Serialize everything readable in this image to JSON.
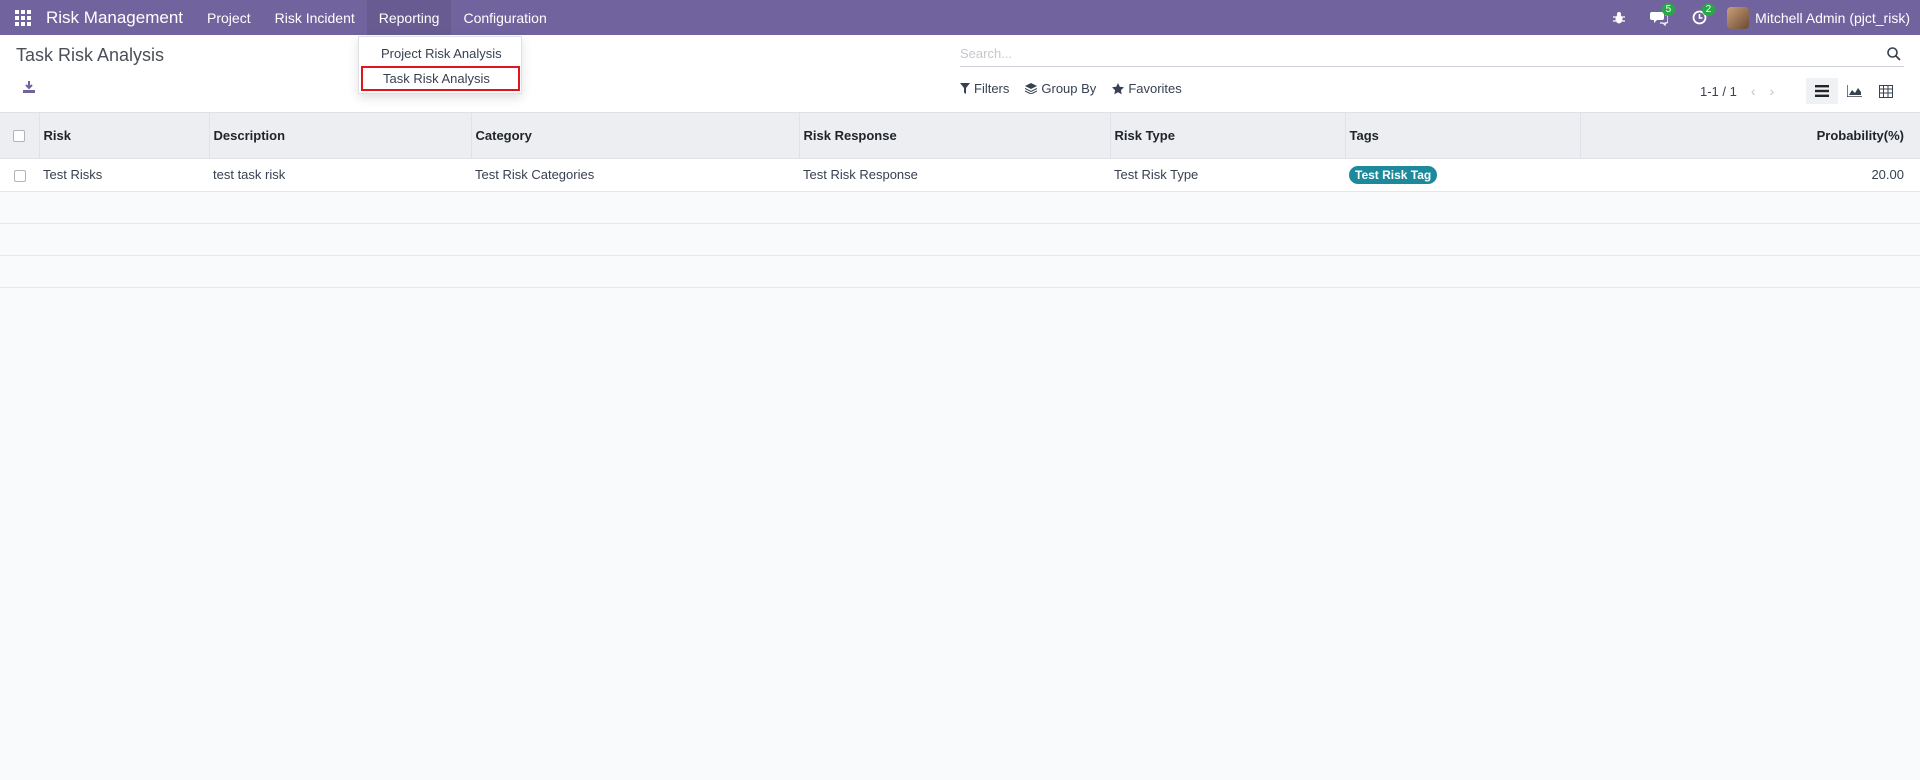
{
  "navbar": {
    "brand": "Risk Management",
    "menu": [
      "Project",
      "Risk Incident",
      "Reporting",
      "Configuration"
    ],
    "messages_badge": "5",
    "activities_badge": "2",
    "user": "Mitchell Admin (pjct_risk)"
  },
  "dropdown": {
    "items": [
      "Project Risk Analysis",
      "Task Risk Analysis"
    ]
  },
  "control_panel": {
    "title": "Task Risk Analysis",
    "search_placeholder": "Search...",
    "filters_label": "Filters",
    "group_by_label": "Group By",
    "favorites_label": "Favorites",
    "pager": "1-1 / 1"
  },
  "table": {
    "headers": [
      "Risk",
      "Description",
      "Category",
      "Risk Response",
      "Risk Type",
      "Tags",
      "Probability(%)"
    ],
    "rows": [
      {
        "risk": "Test Risks",
        "description": "test task risk",
        "category": "Test Risk Categories",
        "risk_response": "Test Risk Response",
        "risk_type": "Test Risk Type",
        "tag": "Test Risk Tag",
        "probability": "20.00"
      }
    ]
  },
  "colors": {
    "navbar": "#71639e",
    "tag": "#1d8a9c",
    "highlight_border": "#e0161f",
    "badge": "#28a745"
  }
}
